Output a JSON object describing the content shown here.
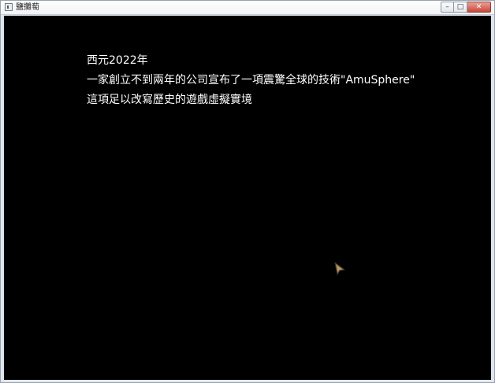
{
  "window": {
    "title": "鹽攤萄",
    "controls": {
      "minimize": "–",
      "maximize": "□",
      "close": "✕"
    }
  },
  "story": {
    "lines": [
      "西元2022年",
      "一家創立不到兩年的公司宣布了一項震驚全球的技術\"AmuSphere\"",
      "這項足以改寫歷史的遊戲虛擬實境"
    ]
  },
  "cursor": {
    "icon": "advance-arrow-cursor-icon"
  },
  "colors": {
    "background": "#000000",
    "text": "#ffffff",
    "cursor": "#7a6a4a"
  }
}
